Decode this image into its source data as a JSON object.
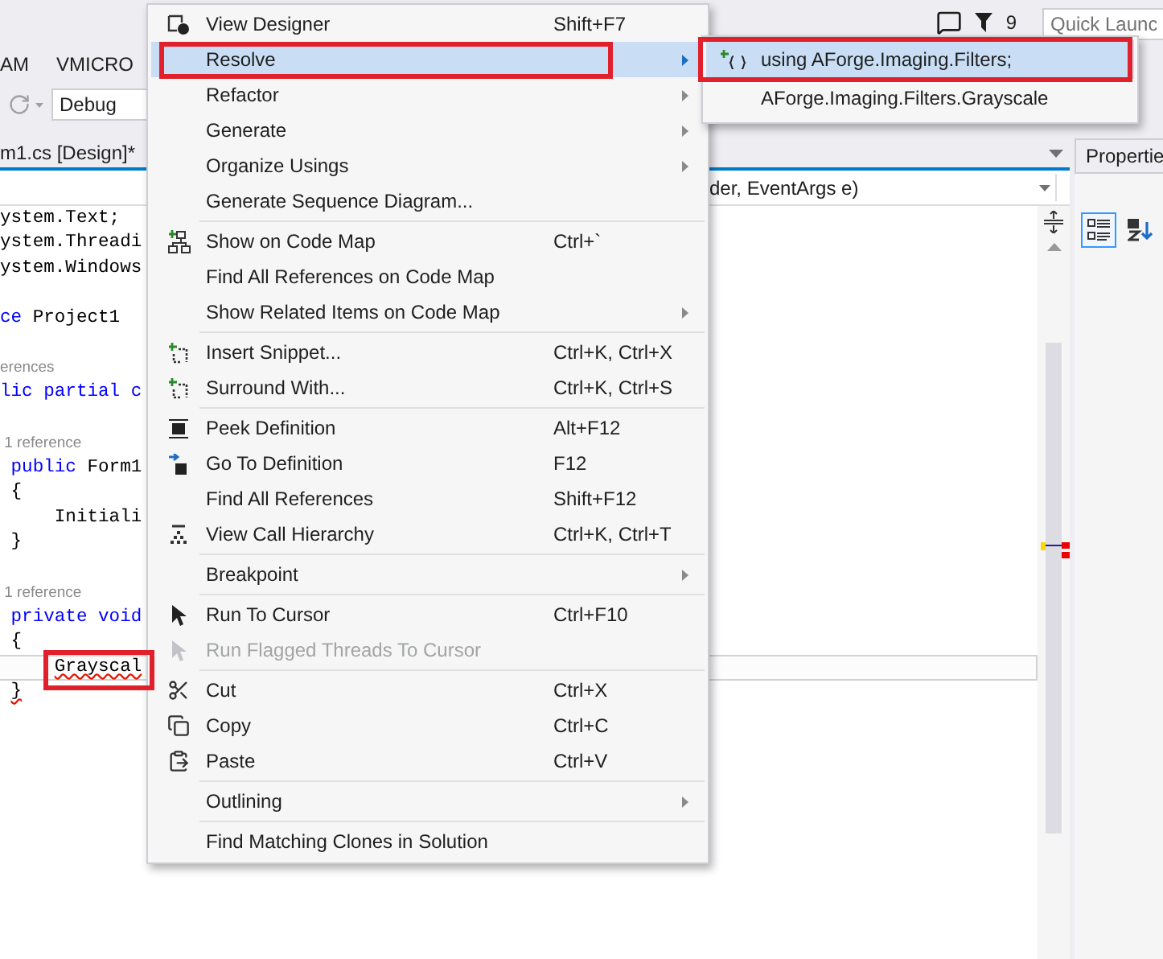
{
  "title_bar": {
    "notification_count": "9",
    "quick_launch": {
      "placeholder": "Quick Launc"
    }
  },
  "menu_bar": [
    "AM",
    "VMICRO"
  ],
  "toolbar": {
    "configuration": "Debug"
  },
  "editor": {
    "tab": {
      "label": "m1.cs [Design]*",
      "selected": true
    },
    "nav_member": "der, EventArgs e)",
    "lines": [
      {
        "kind": "code",
        "tokens": [
          {
            "text": "ystem.Text;",
            "kind": "plain"
          }
        ],
        "current": false,
        "error": false,
        "annotated": false
      },
      {
        "kind": "code",
        "tokens": [
          {
            "text": "ystem.Threadi",
            "kind": "plain"
          }
        ],
        "current": false,
        "error": false,
        "annotated": false
      },
      {
        "kind": "code",
        "tokens": [
          {
            "text": "ystem.Windows",
            "kind": "plain"
          }
        ],
        "current": false,
        "error": false,
        "annotated": false
      },
      {
        "kind": "blank"
      },
      {
        "kind": "code",
        "tokens": [
          {
            "text": "ce",
            "kind": "keyword"
          },
          {
            "text": " Project1",
            "kind": "plain"
          }
        ],
        "current": false,
        "error": false,
        "annotated": false
      },
      {
        "kind": "blank"
      },
      {
        "kind": "lens",
        "text": "erences"
      },
      {
        "kind": "code",
        "tokens": [
          {
            "text": "lic partial c",
            "kind": "keyword"
          }
        ],
        "current": false,
        "error": false,
        "annotated": false
      },
      {
        "kind": "blank"
      },
      {
        "kind": "lens",
        "text": " 1 reference"
      },
      {
        "kind": "code",
        "tokens": [
          {
            "text": " public",
            "kind": "keyword"
          },
          {
            "text": " Form1",
            "kind": "plain"
          }
        ],
        "current": false,
        "error": false,
        "annotated": false
      },
      {
        "kind": "code",
        "tokens": [
          {
            "text": " {",
            "kind": "plain"
          }
        ],
        "current": false,
        "error": false,
        "annotated": false
      },
      {
        "kind": "code",
        "tokens": [
          {
            "text": "     Initiali",
            "kind": "plain"
          }
        ],
        "current": false,
        "error": false,
        "annotated": false
      },
      {
        "kind": "code",
        "tokens": [
          {
            "text": " }",
            "kind": "plain"
          }
        ],
        "current": false,
        "error": false,
        "annotated": false
      },
      {
        "kind": "blank"
      },
      {
        "kind": "lens",
        "text": " 1 reference"
      },
      {
        "kind": "code",
        "tokens": [
          {
            "text": " private void",
            "kind": "keyword"
          }
        ],
        "current": false,
        "error": false,
        "annotated": false
      },
      {
        "kind": "code",
        "tokens": [
          {
            "text": " {",
            "kind": "plain"
          }
        ],
        "current": false,
        "error": false,
        "annotated": false
      },
      {
        "kind": "code",
        "tokens": [
          {
            "text": "     Grayscal",
            "kind": "plain"
          }
        ],
        "current": true,
        "error": true,
        "annotated": true
      },
      {
        "kind": "code",
        "tokens": [
          {
            "text": " }",
            "kind": "plain"
          }
        ],
        "current": false,
        "error": true,
        "annotated": false
      }
    ]
  },
  "properties": {
    "title": "Propertie",
    "categorized": {
      "selected": true
    },
    "alphabetical": {
      "selected": false
    }
  },
  "context_menu": {
    "groups": [
      [
        {
          "label": "View Designer",
          "shortcut": "Shift+F7",
          "has_submenu": false,
          "disabled": false,
          "selected": false,
          "annotated": false
        },
        {
          "label": "Resolve",
          "has_submenu": true,
          "disabled": false,
          "selected": true,
          "annotated": true
        },
        {
          "label": "Refactor",
          "has_submenu": true,
          "disabled": false,
          "selected": false,
          "annotated": false
        },
        {
          "label": "Generate",
          "has_submenu": true,
          "disabled": false,
          "selected": false,
          "annotated": false
        },
        {
          "label": "Organize Usings",
          "has_submenu": true,
          "disabled": false,
          "selected": false,
          "annotated": false
        },
        {
          "label": "Generate Sequence Diagram...",
          "has_submenu": false,
          "disabled": false,
          "selected": false,
          "annotated": false
        }
      ],
      [
        {
          "label": "Show on Code Map",
          "shortcut": "Ctrl+`",
          "has_submenu": false,
          "disabled": false,
          "selected": false,
          "annotated": false
        },
        {
          "label": "Find All References on Code Map",
          "has_submenu": false,
          "disabled": false,
          "selected": false,
          "annotated": false
        },
        {
          "label": "Show Related Items on Code Map",
          "has_submenu": true,
          "disabled": false,
          "selected": false,
          "annotated": false
        }
      ],
      [
        {
          "label": "Insert Snippet...",
          "shortcut": "Ctrl+K, Ctrl+X",
          "has_submenu": false,
          "disabled": false,
          "selected": false,
          "annotated": false
        },
        {
          "label": "Surround With...",
          "shortcut": "Ctrl+K, Ctrl+S",
          "has_submenu": false,
          "disabled": false,
          "selected": false,
          "annotated": false
        }
      ],
      [
        {
          "label": "Peek Definition",
          "shortcut": "Alt+F12",
          "has_submenu": false,
          "disabled": false,
          "selected": false,
          "annotated": false
        },
        {
          "label": "Go To Definition",
          "shortcut": "F12",
          "has_submenu": false,
          "disabled": false,
          "selected": false,
          "annotated": false
        },
        {
          "label": "Find All References",
          "shortcut": "Shift+F12",
          "has_submenu": false,
          "disabled": false,
          "selected": false,
          "annotated": false
        },
        {
          "label": "View Call Hierarchy",
          "shortcut": "Ctrl+K, Ctrl+T",
          "has_submenu": false,
          "disabled": false,
          "selected": false,
          "annotated": false
        }
      ],
      [
        {
          "label": "Breakpoint",
          "has_submenu": true,
          "disabled": false,
          "selected": false,
          "annotated": false
        }
      ],
      [
        {
          "label": "Run To Cursor",
          "shortcut": "Ctrl+F10",
          "has_submenu": false,
          "disabled": false,
          "selected": false,
          "annotated": false
        },
        {
          "label": "Run Flagged Threads To Cursor",
          "has_submenu": false,
          "disabled": true,
          "selected": false,
          "annotated": false
        }
      ],
      [
        {
          "label": "Cut",
          "shortcut": "Ctrl+X",
          "has_submenu": false,
          "disabled": false,
          "selected": false,
          "annotated": false
        },
        {
          "label": "Copy",
          "shortcut": "Ctrl+C",
          "has_submenu": false,
          "disabled": false,
          "selected": false,
          "annotated": false
        },
        {
          "label": "Paste",
          "shortcut": "Ctrl+V",
          "has_submenu": false,
          "disabled": false,
          "selected": false,
          "annotated": false
        }
      ],
      [
        {
          "label": "Outlining",
          "has_submenu": true,
          "disabled": false,
          "selected": false,
          "annotated": false
        }
      ],
      [
        {
          "label": "Find Matching Clones in Solution",
          "has_submenu": false,
          "disabled": false,
          "selected": false,
          "annotated": false
        }
      ]
    ]
  },
  "resolve_submenu": [
    {
      "label": "using AForge.Imaging.Filters;",
      "selected": true,
      "annotated": true
    },
    {
      "label": "AForge.Imaging.Filters.Grayscale",
      "selected": false,
      "annotated": false
    }
  ]
}
